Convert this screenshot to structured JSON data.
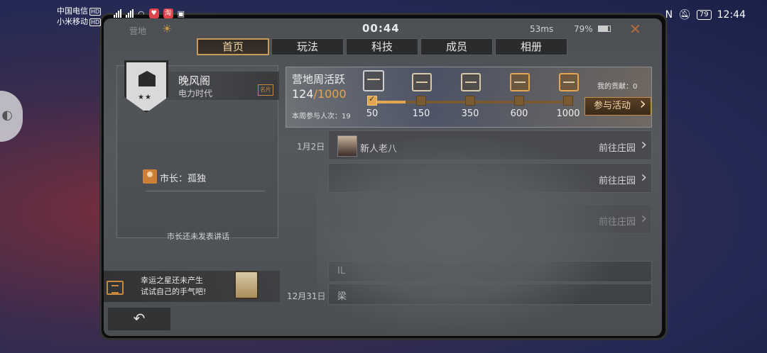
{
  "status_bar": {
    "carrier1": "中国电信",
    "carrier2": "小米移动",
    "hd": "HD",
    "net": "4G",
    "time": "12:44",
    "battery": "79",
    "colors": {
      "text": "#ffffff"
    }
  },
  "game": {
    "top": {
      "camp_label": "营地",
      "timer": "00:44",
      "ping": "53ms",
      "battery": "79%"
    },
    "tabs": [
      {
        "label": "首页",
        "active": true
      },
      {
        "label": "玩法",
        "active": false
      },
      {
        "label": "科技",
        "active": false
      },
      {
        "label": "成员",
        "active": false
      },
      {
        "label": "相册",
        "active": false
      }
    ],
    "guild": {
      "name": "晚风阁",
      "era": "电力时代",
      "card_icon_label": "名片",
      "mayor": "市长：孤独",
      "speech": "市长还未发表讲话"
    },
    "lucky_star": {
      "line1": "幸运之星还未产生",
      "line2": "试试自己的手气吧!"
    },
    "back_label": "↶",
    "weekly": {
      "title": "营地周活跃",
      "current": "124",
      "separator": "/",
      "max": "1000",
      "participants": "本周参与人次：19",
      "contribution": "我的贡献：0",
      "button": "参与活动",
      "milestones": [
        {
          "label": "50",
          "done": true
        },
        {
          "label": "150",
          "done": false
        },
        {
          "label": "350",
          "done": false
        },
        {
          "label": "600",
          "done": false
        },
        {
          "label": "1000",
          "done": false
        }
      ],
      "progress_fraction": 0.124,
      "accent": "#e2a552"
    },
    "feed": {
      "date1": "1月2日",
      "date2": "12月31日",
      "row1_text": "新人老八",
      "link_label": "前往庄园",
      "row5_text": "IL",
      "row6_text": "梁"
    }
  }
}
